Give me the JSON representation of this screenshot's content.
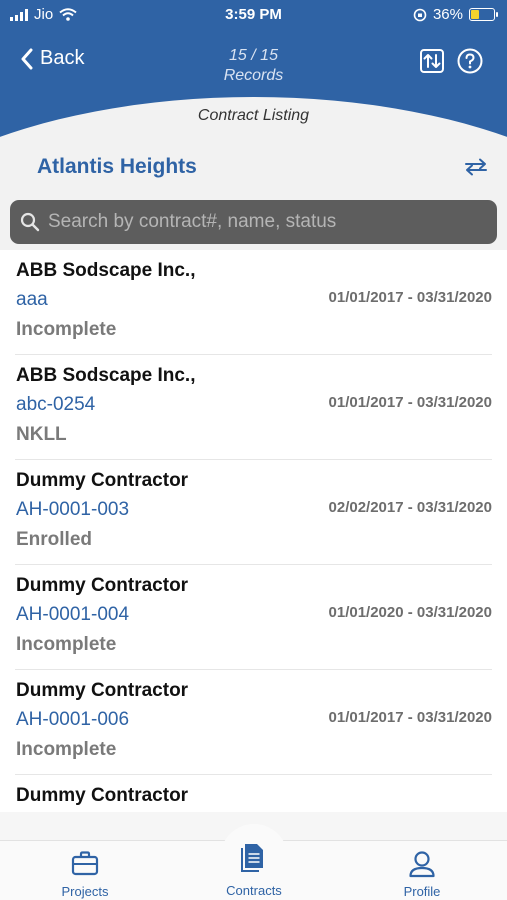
{
  "status_bar": {
    "carrier": "Jio",
    "time": "3:59 PM",
    "battery": "36%",
    "battery_level": 0.36
  },
  "header": {
    "back_label": "Back",
    "record_count": "15 / 15",
    "records_label": "Records",
    "subtitle": "Contract Listing",
    "project_name": "Atlantis Heights",
    "icons": [
      "sort-icon",
      "help-icon",
      "swap-icon"
    ]
  },
  "search": {
    "placeholder": "Search by contract#, name, status"
  },
  "contracts": [
    {
      "name": "ABB Sodscape Inc.,",
      "number": "aaa",
      "status": "Incomplete",
      "dates": "01/01/2017 - 03/31/2020"
    },
    {
      "name": "ABB Sodscape Inc.,",
      "number": "abc-0254",
      "status": "NKLL",
      "dates": "01/01/2017 - 03/31/2020"
    },
    {
      "name": "Dummy Contractor",
      "number": "AH-0001-003",
      "status": "Enrolled",
      "dates": "02/02/2017 - 03/31/2020"
    },
    {
      "name": "Dummy Contractor",
      "number": "AH-0001-004",
      "status": "Incomplete",
      "dates": "01/01/2020 - 03/31/2020"
    },
    {
      "name": "Dummy Contractor",
      "number": "AH-0001-006",
      "status": "Incomplete",
      "dates": "01/01/2017 - 03/31/2020"
    },
    {
      "name": "Dummy Contractor",
      "number": "",
      "status": "",
      "dates": ""
    }
  ],
  "tabs": {
    "projects": "Projects",
    "contracts": "Contracts",
    "profile": "Profile"
  },
  "colors": {
    "brand_blue": "#2f63a5",
    "light_gray": "#f2f2f2",
    "search_bg": "#5d5d5d"
  }
}
